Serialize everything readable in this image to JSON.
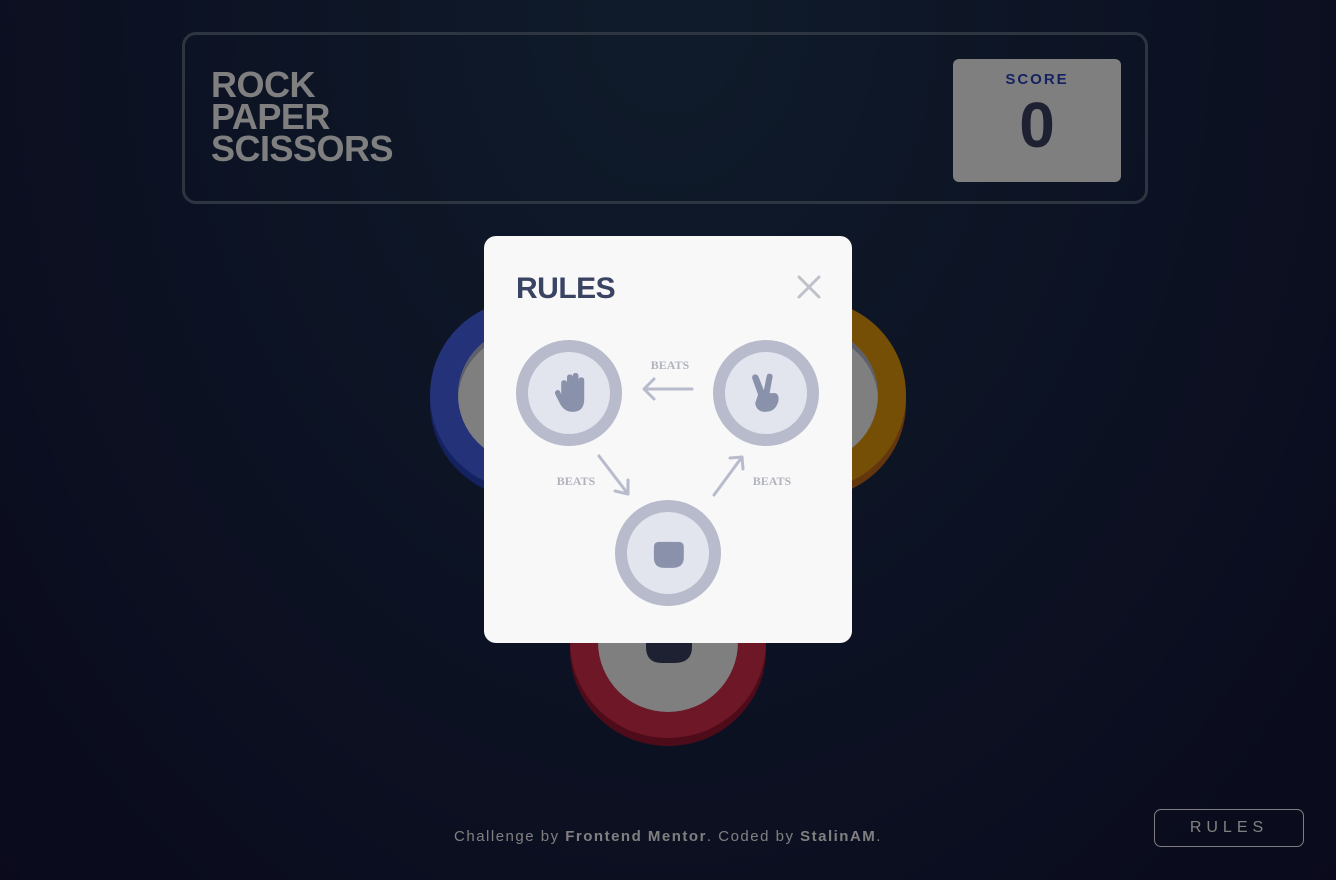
{
  "header": {
    "title_lines": [
      "ROCK",
      "PAPER",
      "SCISSORS"
    ],
    "score_label": "SCORE",
    "score_value": "0"
  },
  "board": {
    "choices": [
      {
        "name": "paper",
        "icon": "hand-paper-icon",
        "color": "#4865f4"
      },
      {
        "name": "scissors",
        "icon": "hand-scissors-icon",
        "color": "#ec9e0e"
      },
      {
        "name": "rock",
        "icon": "hand-rock-icon",
        "color": "#dc2e4e"
      }
    ]
  },
  "modal": {
    "title": "RULES",
    "close_icon": "close-icon",
    "beats_label": "BEATS"
  },
  "footer": {
    "attr_prefix": "Challenge by ",
    "attr_fm": "Frontend Mentor",
    "attr_mid": ". Coded by ",
    "attr_author": "StalinAM",
    "attr_suffix": ".",
    "rules_button": "RULES"
  },
  "colors": {
    "score_label": "#2a45c2",
    "text_dark": "#3b4363",
    "paper": "#4865f4",
    "scissors": "#ec9e0e",
    "rock": "#dc2e4e"
  }
}
